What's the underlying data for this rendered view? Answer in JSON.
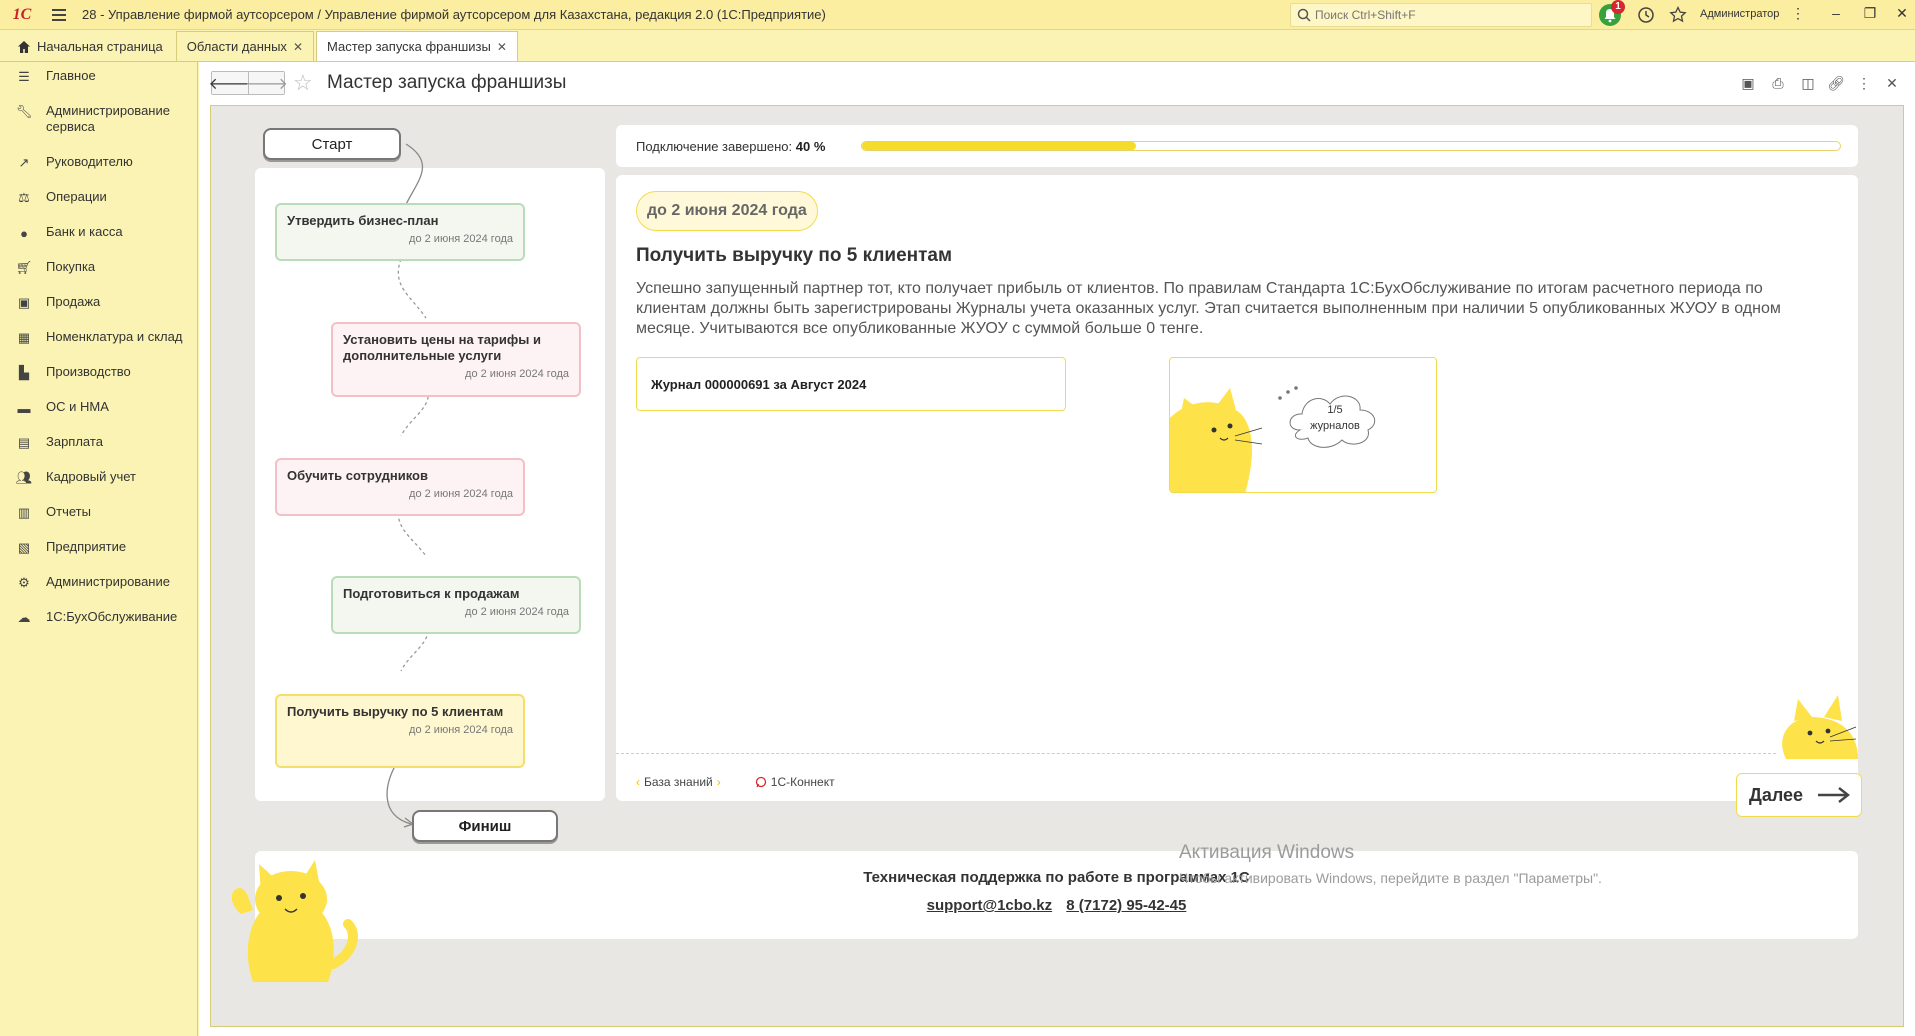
{
  "window": {
    "logo": "1С",
    "title": "28 - Управление фирмой аутсорсером / Управление фирмой аутсорсером для Казахстана, редакция 2.0  (1С:Предприятие)",
    "search_placeholder": "Поиск Ctrl+Shift+F",
    "notifications_count": "1",
    "user": "Администратор"
  },
  "tabs": [
    {
      "label": "Начальная страница"
    },
    {
      "label": "Области данных"
    },
    {
      "label": "Мастер запуска франшизы"
    }
  ],
  "sidebar": {
    "items": [
      {
        "label": "Главное",
        "icon": "menu-icon"
      },
      {
        "label": "Администрирование сервиса",
        "icon": "wrench-icon"
      },
      {
        "label": "Руководителю",
        "icon": "trend-icon"
      },
      {
        "label": "Операции",
        "icon": "operations-icon"
      },
      {
        "label": "Банк и касса",
        "icon": "bank-icon"
      },
      {
        "label": "Покупка",
        "icon": "cart-icon"
      },
      {
        "label": "Продажа",
        "icon": "bag-icon"
      },
      {
        "label": "Номенклатура и склад",
        "icon": "grid-icon"
      },
      {
        "label": "Производство",
        "icon": "factory-icon"
      },
      {
        "label": "ОС и НМА",
        "icon": "truck-icon"
      },
      {
        "label": "Зарплата",
        "icon": "wallet-icon"
      },
      {
        "label": "Кадровый учет",
        "icon": "people-icon"
      },
      {
        "label": "Отчеты",
        "icon": "chart-icon"
      },
      {
        "label": "Предприятие",
        "icon": "building-icon"
      },
      {
        "label": "Администрирование",
        "icon": "gear-icon"
      },
      {
        "label": "1С:БухОбслуживание",
        "icon": "cloud-icon"
      }
    ]
  },
  "page": {
    "title": "Мастер запуска франшизы"
  },
  "wizard": {
    "start_label": "Старт",
    "finish_label": "Финиш",
    "steps": [
      {
        "name": "Утвердить бизнес-план",
        "date": "до 2 июня 2024 года",
        "status": "green"
      },
      {
        "name": "Установить цены на тарифы и дополнительные услуги",
        "date": "до 2 июня 2024 года",
        "status": "pink"
      },
      {
        "name": "Обучить сотрудников",
        "date": "до 2 июня 2024 года",
        "status": "pink"
      },
      {
        "name": "Подготовиться к продажам",
        "date": "до 2 июня 2024 года",
        "status": "green"
      },
      {
        "name": "Получить выручку по 5 клиентам",
        "date": "до 2 июня 2024 года",
        "status": "yellow"
      }
    ],
    "progress": {
      "label": "Подключение завершено:",
      "value_text": "40 %",
      "fraction": 0.28
    },
    "detail": {
      "deadline": "до 2 июня 2024 года",
      "title": "Получить выручку по 5 клиентам",
      "description": "Успешно запущенный партнер тот, кто получает прибыль от клиентов. По правилам Стандарта 1С:БухОбслуживание по итогам расчетного периода по клиентам должны быть зарегистрированы Журналы учета оказанных услуг. Этап считается выполненным при наличии 5 опубликованных ЖУОУ в одном месяце. Учитываются все опубликованные ЖУОУ с суммой больше 0 тенге.",
      "journal": "Журнал 000000691 за Август 2024",
      "counter_line1": "1/5",
      "counter_line2": "журналов"
    },
    "links": {
      "knowledge_base": "База знаний",
      "connect": "1С-Коннект"
    },
    "next_label": "Далее"
  },
  "support": {
    "title": "Техническая поддержка по работе в программах 1С",
    "email": "support@1cbo.kz",
    "phone": "8 (7172) 95-42-45"
  },
  "activation": {
    "line1": "Активация Windows",
    "line2": "Чтобы активировать Windows, перейдите в раздел \"Параметры\"."
  },
  "colors": {
    "accent_yellow": "#f5dc2a",
    "chrome_yellow": "#fbf3b3",
    "logo_red": "#c8202f",
    "notify_green": "#37a23c"
  }
}
